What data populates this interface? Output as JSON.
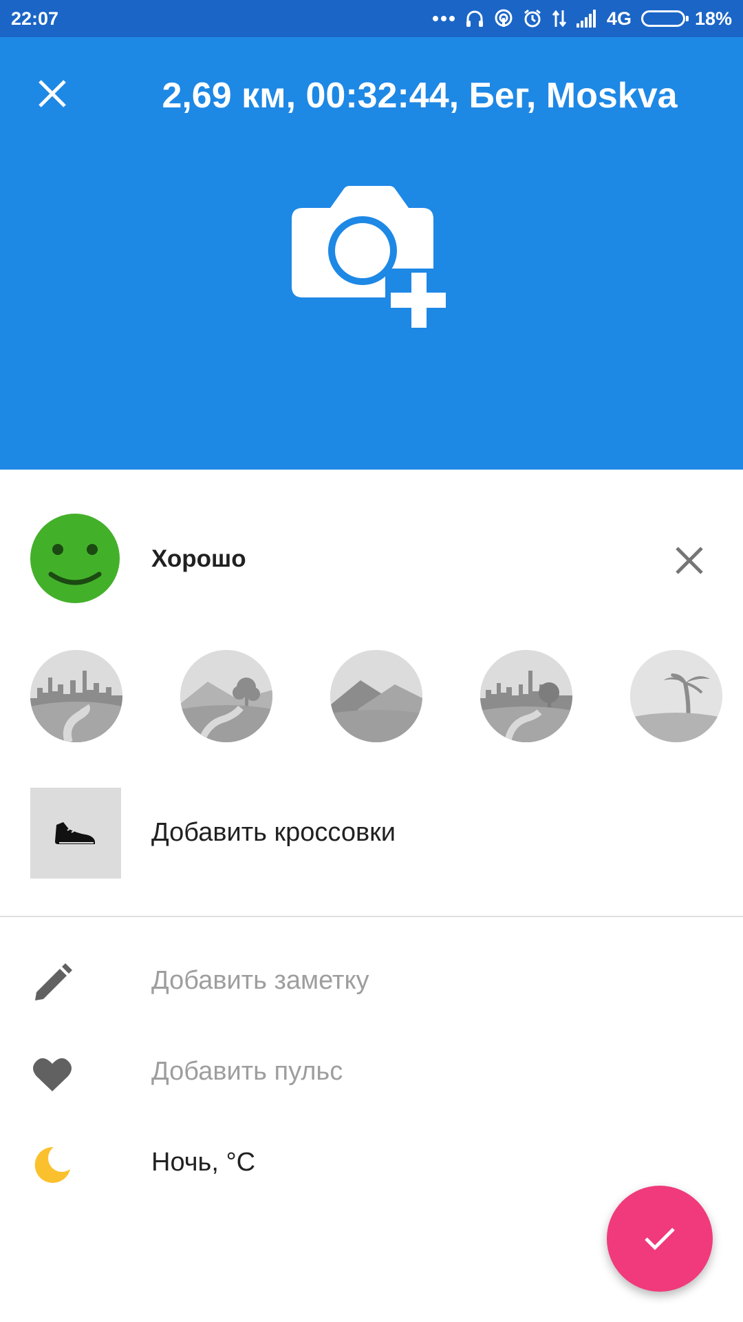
{
  "status_bar": {
    "time": "22:07",
    "network": "4G",
    "battery": "18%",
    "battery_level": 0.18,
    "icons": [
      "more-dots-icon",
      "headphones-icon",
      "hotspot-icon",
      "alarm-icon",
      "data-transfer-icon",
      "signal-icon",
      "battery-icon"
    ]
  },
  "header": {
    "title": "2,69 км, 00:32:44, Бег, Moskva",
    "background_color": "#1e88e5",
    "close_icon": "close-icon",
    "photo_icon": "camera-add-icon"
  },
  "feeling": {
    "label": "Хорошо",
    "icon": "smiley-icon",
    "color": "#43b02a",
    "clear_icon": "close-icon"
  },
  "terrain": {
    "options": [
      "city-road",
      "trail-park",
      "hills",
      "city-park",
      "beach"
    ]
  },
  "shoes": {
    "label": "Добавить кроссовки",
    "icon": "shoe-icon"
  },
  "note": {
    "label": "Добавить заметку",
    "icon": "pencil-icon"
  },
  "pulse": {
    "label": "Добавить пульс",
    "icon": "heart-icon"
  },
  "weather": {
    "label": "Ночь,  °C",
    "icon": "moon-icon",
    "icon_color": "#fbc02d"
  },
  "fab": {
    "icon": "check-icon",
    "color": "#f03a7b"
  }
}
